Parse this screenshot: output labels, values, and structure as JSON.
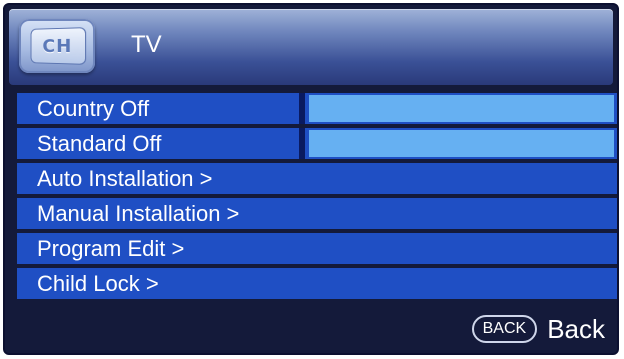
{
  "header": {
    "badge_text": "CH",
    "title": "TV"
  },
  "menu": {
    "items": [
      {
        "label": "Country Off",
        "has_value": true
      },
      {
        "label": "Standard Off",
        "has_value": true
      },
      {
        "label": "Auto Installation >",
        "has_value": false
      },
      {
        "label": "Manual Installation >",
        "has_value": false
      },
      {
        "label": "Program Edit >",
        "has_value": false
      },
      {
        "label": "Child Lock >",
        "has_value": false
      }
    ]
  },
  "footer": {
    "back_key": "BACK",
    "back_label": "Back"
  },
  "colors": {
    "background": "#141a3a",
    "row": "#1f4fc4",
    "value_box": "#66b0f2",
    "text": "#ffffff"
  }
}
